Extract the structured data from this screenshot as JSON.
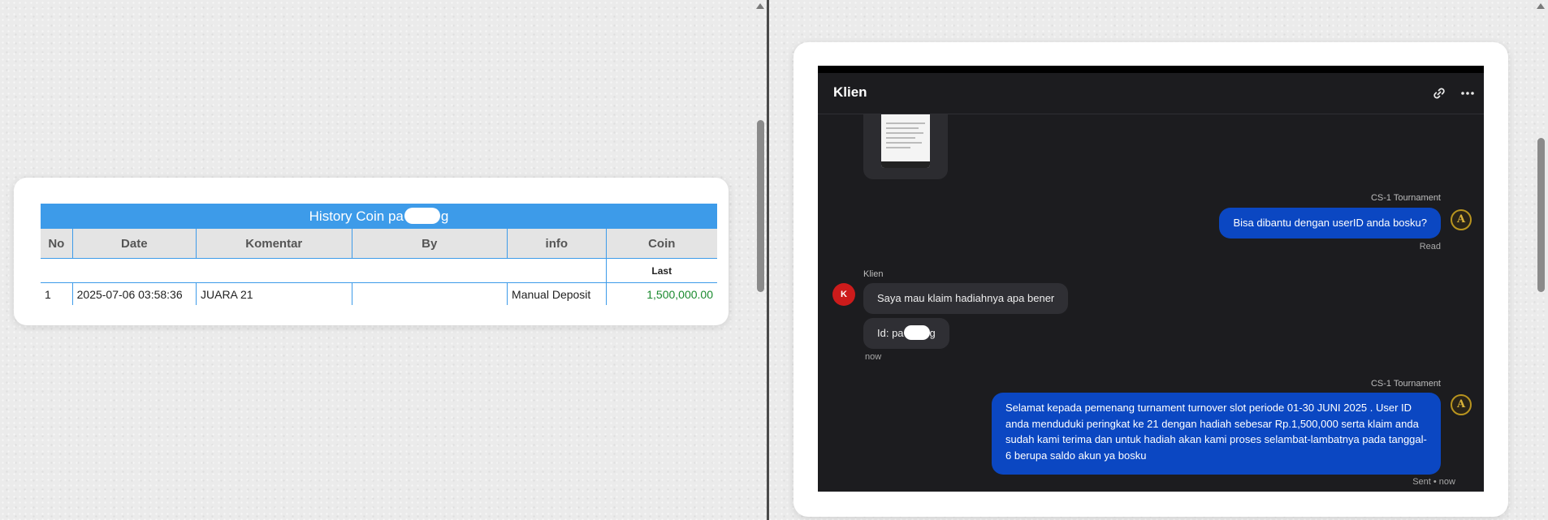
{
  "history": {
    "title_prefix": "History Coin pa",
    "title_suffix": "g",
    "columns": [
      "No",
      "Date",
      "Komentar",
      "By",
      "info",
      "Coin"
    ],
    "sub_header_last": "Last",
    "rows": [
      {
        "no": "1",
        "date": "2025-07-06 03:58:36",
        "komentar": "JUARA 21",
        "by": "",
        "info": "Manual Deposit",
        "coin": "1,500,000.00"
      }
    ]
  },
  "chat": {
    "title": "Klien",
    "header_icons": [
      "link-icon",
      "more-icon"
    ],
    "messages": [
      {
        "sender": "CS-1 Tournament",
        "text": "Bisa dibantu dengan userID anda bosku?",
        "status": "Read"
      },
      {
        "sender": "Klien",
        "avatar_initial": "K",
        "text": "Saya mau klaim hadiahnya apa bener"
      },
      {
        "text_prefix": "Id: pa",
        "text_suffix": "g",
        "time": "now"
      },
      {
        "sender": "CS-1 Tournament",
        "text": "Selamat kepada pemenang turnament turnover slot periode 01-30 JUNI 2025 . User ID anda menduduki peringkat ke 21 dengan hadiah sebesar Rp.1,500,000 serta klaim anda sudah kami terima dan untuk hadiah akan kami proses selambat-lambatnya pada tanggal- 6 berupa saldo akun ya bosku",
        "status": "Sent • now"
      }
    ],
    "agent_avatar_letter": "A"
  },
  "colors": {
    "table_header": "#3d9be9",
    "coin_value": "#1a8a2e",
    "chat_bg": "#1c1c1f",
    "outgoing_bubble": "#0b47c2",
    "incoming_bubble": "#2f2f34",
    "client_avatar": "#cc1b1b"
  }
}
